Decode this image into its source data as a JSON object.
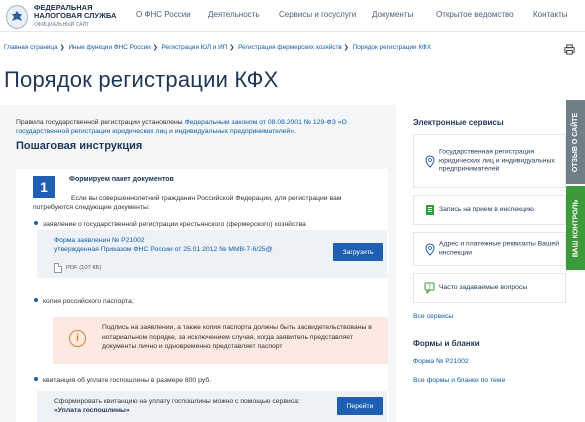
{
  "header": {
    "logo_title_line1": "ФЕДЕРАЛЬНАЯ",
    "logo_title_line2": "НАЛОГОВАЯ СЛУЖБА",
    "logo_sub": "ОФИЦИАЛЬНЫЙ САЙТ",
    "nav": [
      "О ФНС России",
      "Деятельность",
      "Сервисы и госуслуги",
      "Документы",
      "Открытое ведомство",
      "Контакты"
    ]
  },
  "breadcrumb": [
    "Главная страница",
    "Иные функции ФНС России",
    "Регистрация ЮЛ и ИП",
    "Регистрация фермерских хозяйств",
    "Порядок регистрации КФХ"
  ],
  "page_title": "Порядок регистрации КФХ",
  "intro": {
    "prefix": "Правила государственной регистрации установлены ",
    "link": "Федеральным законом от 08.08.2001 № 129-ФЗ «О государственной регистрации юридических лиц и индивидуальных предпринимателей»",
    "suffix": "."
  },
  "section_title": "Пошаговая инструкция",
  "step": {
    "number": "1",
    "title": "Формируем пакет документов",
    "text": "Если вы совершеннолетний гражданин Российской Федерации, для регистрации вам потребуются следующие документы:",
    "bullet1": "заявление о государственной регистрации крестьянского (фермерского) хозяйства",
    "form_link_line1": "Форма заявления № Р21002",
    "form_link_line2": "утвержденная Приказом ФНС России от 25.01.2012 № ММВ-7-6/25@",
    "pdf_label": "PDF (107 КБ)",
    "download_btn": "Загрузить",
    "bullet2": "копия российского паспорта;",
    "warning": "Подпись на заявлении, а также копия паспорта должны быть засвидетельствованы в нотариальном порядке, за исключением случая, когда заявитель представляет документы лично и одновременно представляет паспорт",
    "bullet3": "квитанция об уплате госпошлины в размере 800 руб.",
    "pay_text": "Сформировать квитанцию на уплату госпошлины можно с помощью сервиса: ",
    "pay_service": "«Уплата госпошлины»",
    "go_btn": "Перейти"
  },
  "sidebar": {
    "services_title": "Электронные сервисы",
    "services": [
      {
        "label": "Государственная регистрация юридических лиц и индивидуальных предпринимателей",
        "icon": "location-pin-icon"
      },
      {
        "label": "Запись на прием в инспекцию",
        "icon": "document-icon"
      },
      {
        "label": "Адрес и платежные реквизиты Вашей инспекции",
        "icon": "location-pin-icon"
      },
      {
        "label": "Часто задаваемые вопросы",
        "icon": "question-bubble-icon"
      }
    ],
    "all_services": "Все сервисы",
    "forms_title": "Формы и бланки",
    "form_link": "Форма № Р21002",
    "all_forms": "Все формы и бланки по теме"
  },
  "tabs": {
    "feedback": "ОТЗЫВ О САЙТЕ",
    "control": "ВАШ КОНТРОЛЬ"
  },
  "colors": {
    "primary": "#1f5fb3",
    "link": "#0f5da8",
    "feedback_tab": "#6f7f88",
    "control_tab": "#3d9a3a",
    "warning_bg": "#fbe9e2"
  }
}
